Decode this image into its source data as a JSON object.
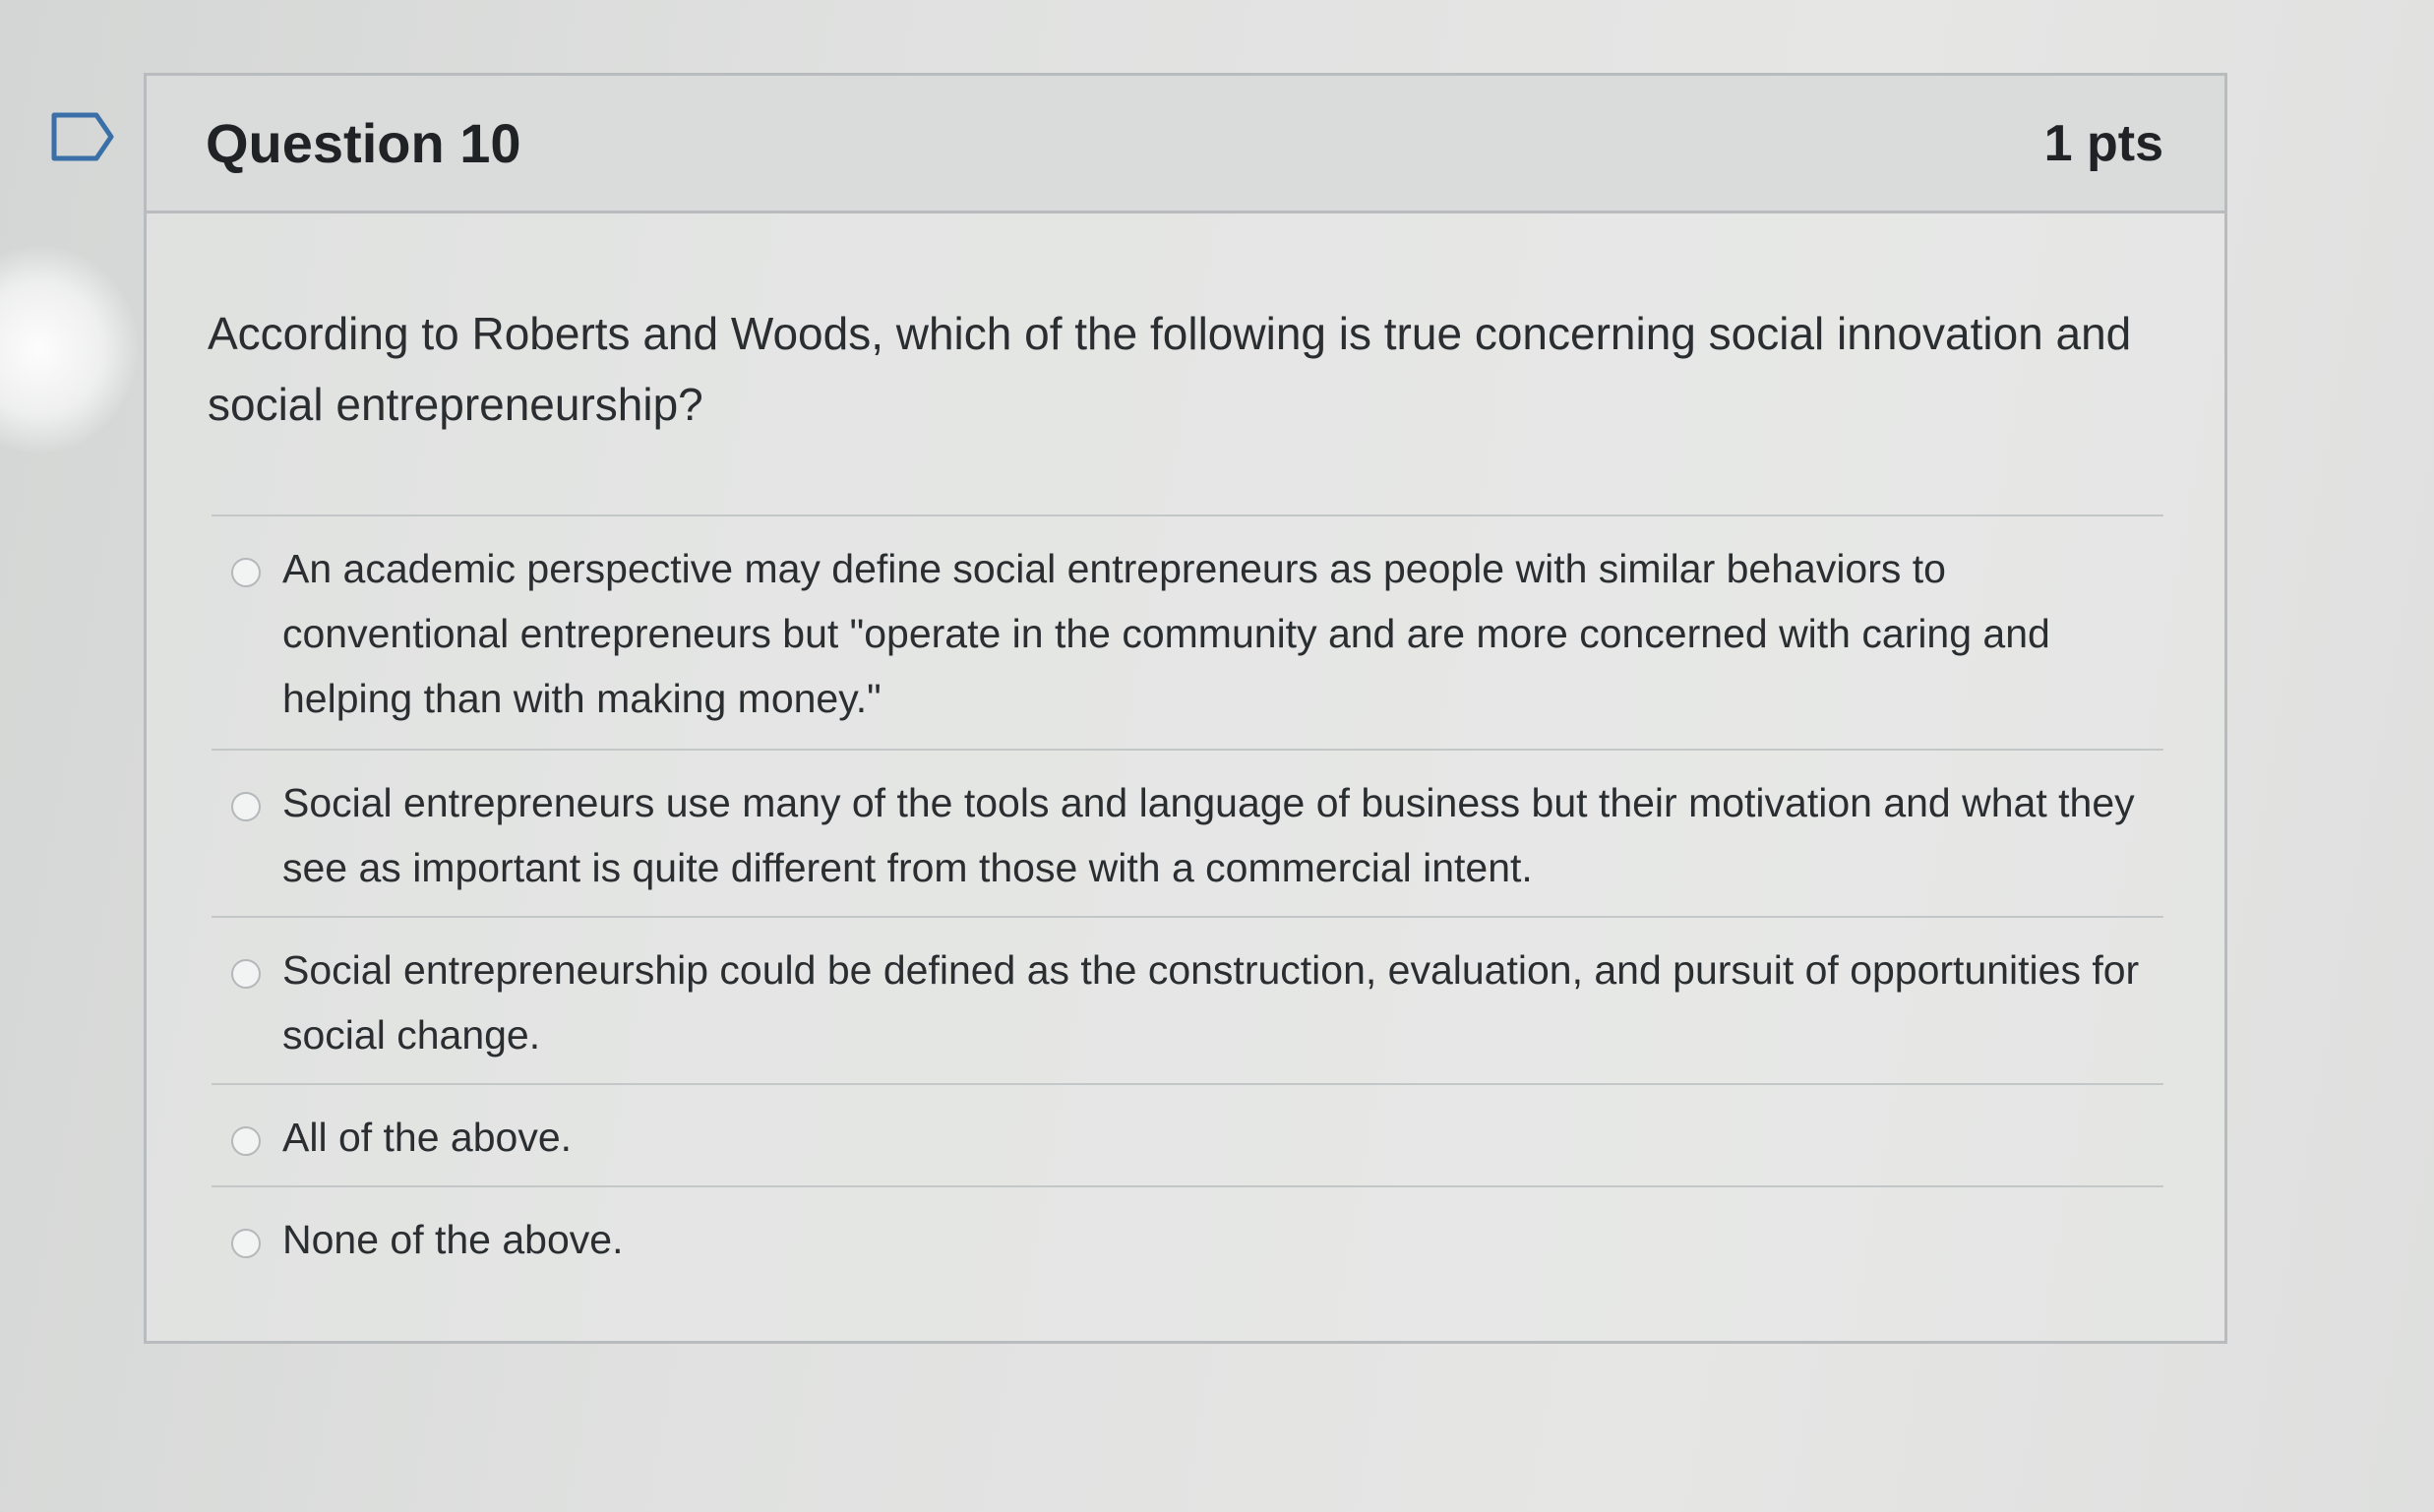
{
  "question": {
    "title": "Question 10",
    "points": "1 pts",
    "text": "According to Roberts and Woods, which of the following is true concerning social innovation and social entrepreneurship?"
  },
  "answers": [
    {
      "label": "An academic perspective may define social entrepreneurs as people with similar behaviors to conventional entrepreneurs but \"operate in the community and are more concerned with caring and helping than with making money.\"",
      "selected": false
    },
    {
      "label": "Social entrepreneurs use many of the tools and language of business but their motivation and what they see as important is quite different from those with a commercial intent.",
      "selected": false
    },
    {
      "label": "Social entrepreneurship could be defined as the construction, evaluation, and pursuit of opportunities for social change.",
      "selected": false
    },
    {
      "label": "All of the above.",
      "selected": false
    },
    {
      "label": "None of the above.",
      "selected": false
    }
  ],
  "icons": {
    "flag": "bookmark-flag-icon"
  },
  "colors": {
    "text": "#2a2e31",
    "header_bg": "#dadcdb",
    "border": "#b8bcbe"
  }
}
